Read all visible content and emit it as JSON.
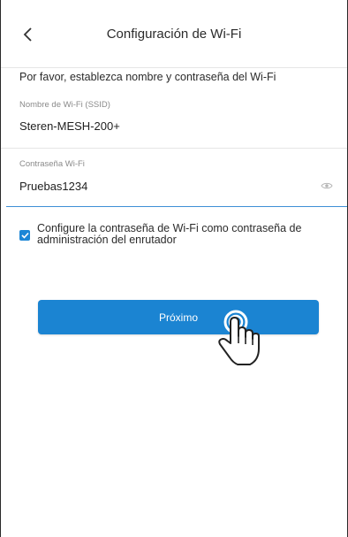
{
  "header": {
    "title": "Configuración de Wi-Fi",
    "back_icon": "chevron-left-icon"
  },
  "intro_text": "Por favor, establezca nombre y contraseña del Wi-Fi",
  "ssid_field": {
    "label": "Nombre de Wi-Fi (SSID)",
    "value": "Steren-MESH-200+"
  },
  "password_field": {
    "label": "Contraseña Wi-Fi",
    "value": "Pruebas1234",
    "toggle_icon": "eye-icon"
  },
  "admin_checkbox": {
    "checked": true,
    "label": "Configure la contraseña de Wi-Fi como contraseña de administración del enrutador"
  },
  "next_button": {
    "label": "Próximo"
  },
  "cursor_icon": "hand-pointer-icon",
  "colors": {
    "accent": "#1b84d2",
    "focus_line": "#3f8fd6",
    "divider": "#e6e6e6"
  }
}
